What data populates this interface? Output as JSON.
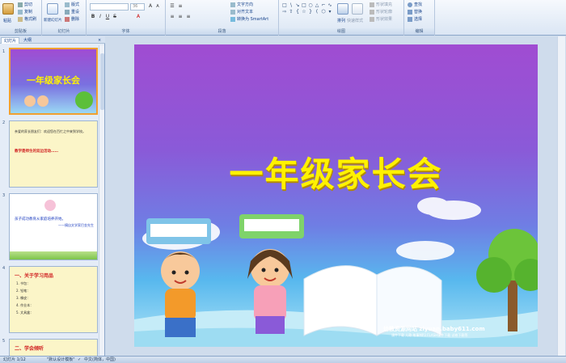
{
  "ribbon": {
    "clipboard": {
      "label": "剪贴板",
      "paste": "粘贴",
      "cut": "剪切",
      "copy": "复制",
      "format_painter": "格式刷"
    },
    "slides": {
      "label": "幻灯片",
      "new_slide": "新建幻灯片",
      "layout": "版式",
      "reset": "重设",
      "delete": "删除"
    },
    "font": {
      "label": "字体",
      "font_name": "",
      "font_size": "36"
    },
    "paragraph": {
      "label": "段落",
      "text_direction": "文字方向",
      "align_text": "对齐文本",
      "smartart": "转换为 SmartArt"
    },
    "drawing": {
      "label": "绘图",
      "arrange": "排列",
      "quick_styles": "快速样式",
      "shape_fill": "形状填充",
      "shape_outline": "形状轮廓",
      "shape_effects": "形状效果"
    },
    "editing": {
      "label": "编辑",
      "find": "查找",
      "replace": "替换",
      "select": "选择"
    }
  },
  "left_pane": {
    "tab_slides": "幻灯片",
    "tab_outline": "大纲",
    "thumbs": [
      {
        "num": "1",
        "title": "一年级家长会"
      },
      {
        "num": "2",
        "text": "亲爱的家长朋友们：欢迎您在百忙之中来到学校。",
        "highlight": "教学是师生的双边活动……"
      },
      {
        "num": "3",
        "text": "孩子成功教育从家庭培养开始。",
        "caption": "——摘自文学家巴金先生"
      },
      {
        "num": "4",
        "heading": "一、关于学习用品",
        "items": [
          "1. 书包：",
          "2. 铅笔：",
          "3. 橡皮：",
          "4. 作业本：",
          "5. 文具盒："
        ]
      },
      {
        "num": "5",
        "heading": "二、学会倾听"
      }
    ]
  },
  "slide": {
    "title": "一年级家长会",
    "watermark_line1": "幼教资源网站 ziyuan.baby611.com",
    "watermark_line2": "课件下载 儿歌 故事MP3 FLASH课件下载 试卷下载等"
  },
  "status": {
    "slide_count": "幻灯片 1/12",
    "theme": "\"默认设计模板\"",
    "language": "中文(简体，中国)"
  },
  "colors": {
    "title_yellow": "#fff200",
    "slide_purple": "#a04cd2",
    "ribbon_blue": "#dbe6f4"
  }
}
